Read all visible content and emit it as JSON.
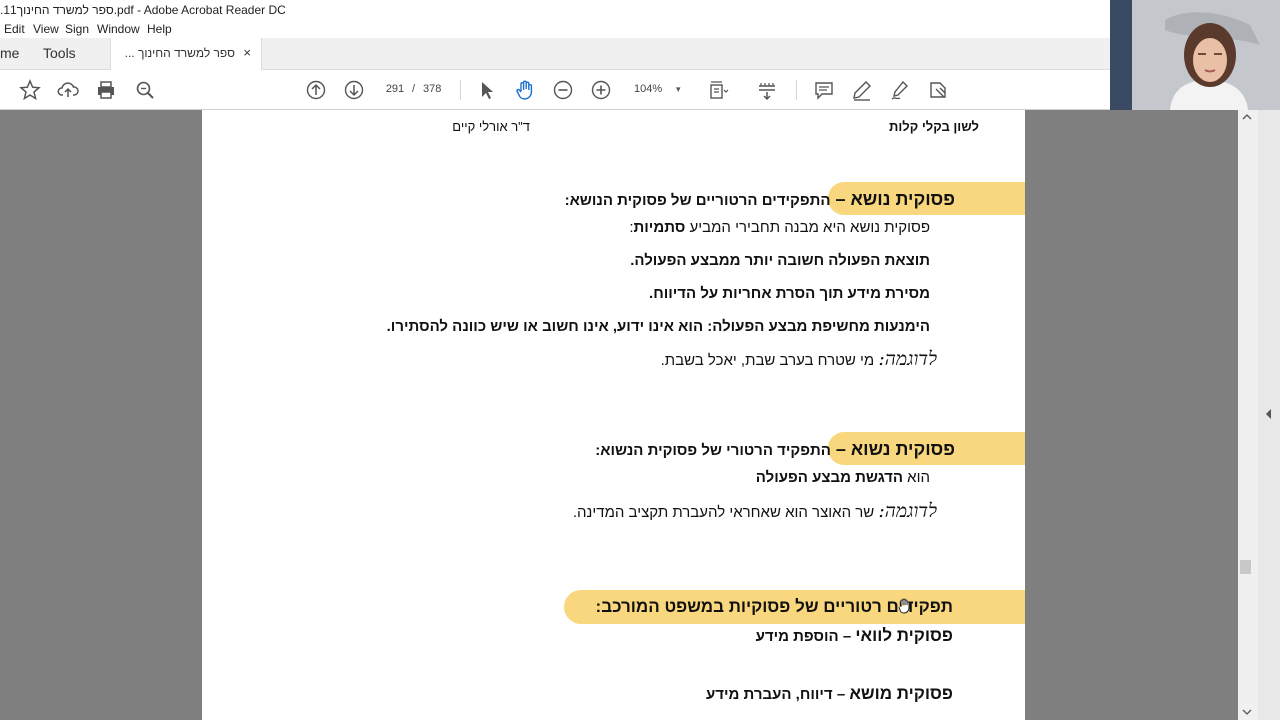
{
  "window": {
    "title": ".11ספר למשרד החינוך.pdf - Adobe Acrobat Reader DC"
  },
  "menu": [
    "Edit",
    "View",
    "Sign",
    "Window",
    "Help"
  ],
  "tabs": {
    "home": "me",
    "tools": "Tools",
    "document": "ספר למשרד החינוך ...",
    "close": "×"
  },
  "toolbar": {
    "page_current": "291",
    "page_sep": "/",
    "page_total": "378",
    "zoom": "104%",
    "zoom_caret": "▾"
  },
  "header": {
    "right": "לשון בקלי קלות",
    "left": "ד\"ר אורלי קיים"
  },
  "section1": {
    "title": "פסוקית נושא – ",
    "title_rest": "התפקידים הרטוריים של פסוקית הנושא:",
    "line1_plain": "פסוקית נושא היא מבנה תחבירי המביע ",
    "line1_bold": "סתמיות",
    "line1_end": ":",
    "line2": "תוצאת הפעולה חשובה יותר ממבצע הפעולה.",
    "line3": "מסירת מידע  תוך הסרת אחריות על הדיווח.",
    "line4": "הימנעות מחשיפת מבצע הפעולה: הוא אינו ידוע, אינו חשוב או שיש כוונה להסתירו.",
    "example_label": "לדוגמה:",
    "example": " מי שטרח בערב שבת, יאכל בשבת."
  },
  "section2": {
    "title": "פסוקית נשוא – ",
    "title_rest": "התפקיד הרטורי של פסוקית הנשוא:",
    "line1_plain": "הוא ",
    "line1_bold": "הדגשת מבצע הפעולה",
    "example_label": "לדוגמה:",
    "example": " שר האוצר הוא שאחראי להעברת תקציב המדינה."
  },
  "section3": {
    "title": "תפקידים רטוריים של פסוקיות במשפט המורכב:",
    "item1_bold": "פסוקית לוואי",
    "item1_rest": " – הוספת מידע",
    "item2_bold": "פסוקית מושא",
    "item2_rest": " – דיווח, העברת מידע"
  },
  "colors": {
    "highlight": "#f9d77e",
    "viewer_bg": "#7f7f7f"
  }
}
